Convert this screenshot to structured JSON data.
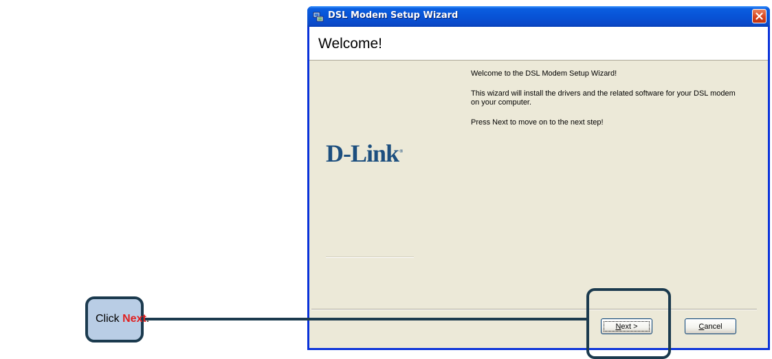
{
  "window": {
    "title": "DSL Modem Setup Wizard",
    "title_icon": "setup-wizard-icon",
    "close_icon": "close-icon"
  },
  "header": {
    "title": "Welcome!"
  },
  "logo": {
    "text": "D-Link",
    "trademark": "®"
  },
  "body": {
    "line1": "Welcome to the DSL Modem Setup Wizard!",
    "line2": "This wizard will install the drivers and the related software for your DSL modem on your computer.",
    "line3": "Press Next to move on to the next step!"
  },
  "buttons": {
    "next_mnemonic": "N",
    "next_rest": "ext >",
    "cancel_mnemonic": "C",
    "cancel_rest": "ancel"
  },
  "callout": {
    "prefix": "Click ",
    "emphasis": "Next",
    "suffix": "."
  },
  "colors": {
    "titlebar": "#0853d6",
    "dialog_bg": "#ece9d8",
    "logo": "#1d4f7f",
    "callout_fill": "#b9cde5",
    "callout_border": "#1b3a4e",
    "callout_emphasis": "#e02020"
  }
}
